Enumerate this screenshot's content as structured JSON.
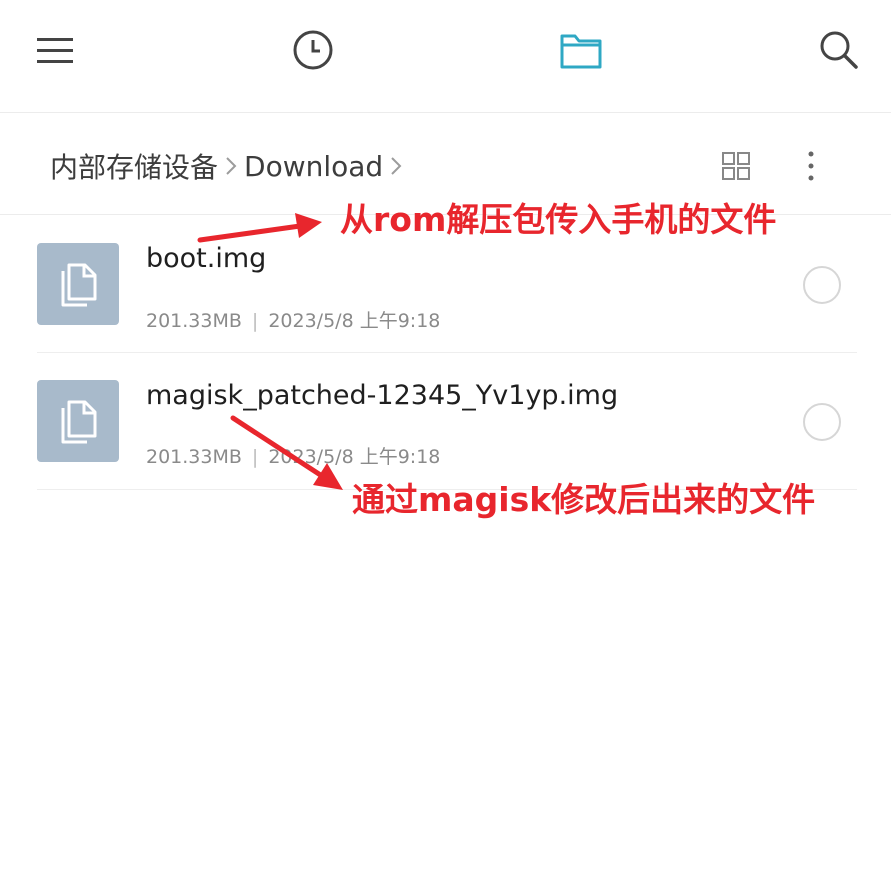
{
  "topbar": {
    "icons": [
      "menu-icon",
      "clock-icon",
      "folder-icon",
      "search-icon"
    ],
    "active_color": "#2fa8c4"
  },
  "breadcrumb": {
    "root": "内部存储设备",
    "current": "Download"
  },
  "files": [
    {
      "name": "boot.img",
      "size": "201.33MB",
      "date": "2023/5/8 上午9:18"
    },
    {
      "name": "magisk_patched-12345_Yv1yp.img",
      "size": "201.33MB",
      "date": "2023/5/8 上午9:18"
    }
  ],
  "annotations": {
    "top": "从rom解压包传入手机的文件",
    "bottom": "通过magisk修改后出来的文件",
    "color": "#e8262d"
  }
}
